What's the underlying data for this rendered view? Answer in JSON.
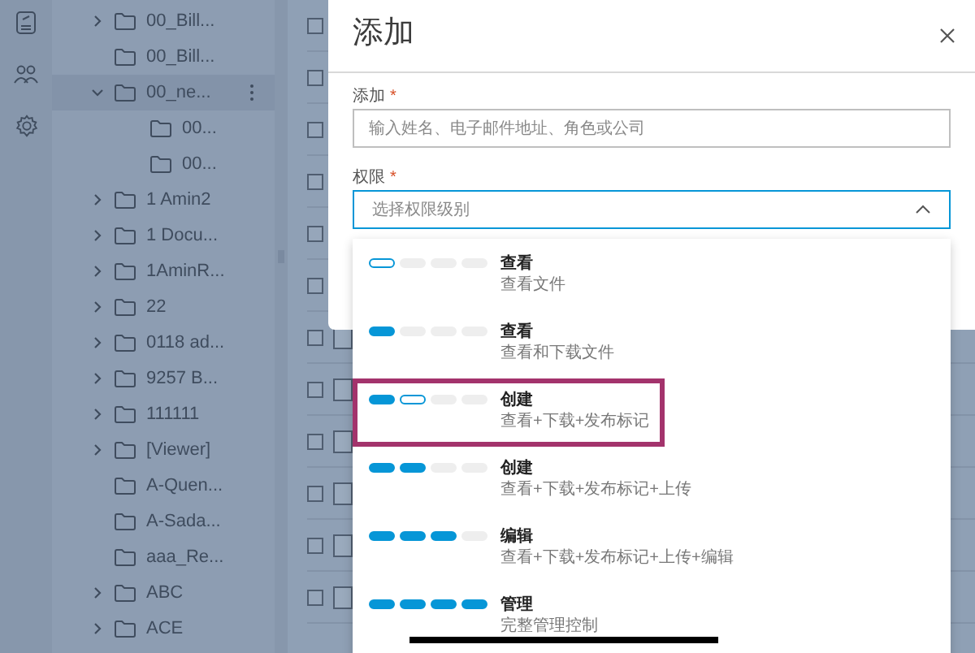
{
  "tree": [
    {
      "label": "00_Bill...",
      "expandable": true,
      "expanded": false,
      "selected": false
    },
    {
      "label": "00_Bill...",
      "expandable": false,
      "selected": false
    },
    {
      "label": "00_ne...",
      "expandable": true,
      "expanded": true,
      "selected": true,
      "children": [
        {
          "label": "00..."
        },
        {
          "label": "00..."
        }
      ]
    },
    {
      "label": "1 Amin2",
      "expandable": true,
      "expanded": false,
      "selected": false
    },
    {
      "label": "1 Docu...",
      "expandable": true,
      "expanded": false,
      "selected": false
    },
    {
      "label": "1AminR...",
      "expandable": true,
      "expanded": false,
      "selected": false
    },
    {
      "label": "22",
      "expandable": true,
      "expanded": false,
      "selected": false
    },
    {
      "label": "0118 ad...",
      "expandable": true,
      "expanded": false,
      "selected": false
    },
    {
      "label": "9257 B...",
      "expandable": true,
      "expanded": false,
      "selected": false
    },
    {
      "label": "111111",
      "expandable": true,
      "expanded": false,
      "selected": false
    },
    {
      "label": "[Viewer]",
      "expandable": true,
      "expanded": false,
      "selected": false
    },
    {
      "label": "A-Quen...",
      "expandable": false,
      "selected": false
    },
    {
      "label": "A-Sada...",
      "expandable": false,
      "selected": false
    },
    {
      "label": "aaa_Re...",
      "expandable": false,
      "selected": false
    },
    {
      "label": "ABC",
      "expandable": true,
      "expanded": false,
      "selected": false
    },
    {
      "label": "ACE",
      "expandable": true,
      "expanded": false,
      "selected": false
    }
  ],
  "rows": [
    {
      "checked": false,
      "thumbnail": false
    },
    {
      "checked": false,
      "thumbnail": false
    },
    {
      "checked": false,
      "thumbnail": false
    },
    {
      "checked": false,
      "thumbnail": false
    },
    {
      "checked": false,
      "thumbnail": false
    },
    {
      "checked": false,
      "thumbnail": false
    },
    {
      "checked": false,
      "thumbnail": true
    },
    {
      "checked": false,
      "thumbnail": true
    },
    {
      "checked": false,
      "thumbnail": true
    },
    {
      "checked": false,
      "thumbnail": true
    },
    {
      "checked": false,
      "thumbnail": true
    },
    {
      "checked": false,
      "thumbnail": true
    }
  ],
  "dialog": {
    "title": "添加",
    "add_field": {
      "label": "添加",
      "required_mark": "*",
      "placeholder": "输入姓名、电子邮件地址、角色或公司"
    },
    "permission_field": {
      "label": "权限",
      "required_mark": "*",
      "placeholder": "选择权限级别",
      "expanded": true
    },
    "options": [
      {
        "title": "查看",
        "description": "查看文件",
        "highlighted": false,
        "pips": [
          {
            "kind": "outline"
          },
          {
            "kind": "empty"
          },
          {
            "kind": "empty"
          },
          {
            "kind": "empty"
          }
        ]
      },
      {
        "title": "查看",
        "description": "查看和下载文件",
        "highlighted": false,
        "pips": [
          {
            "kind": "filled"
          },
          {
            "kind": "empty"
          },
          {
            "kind": "empty"
          },
          {
            "kind": "empty"
          }
        ]
      },
      {
        "title": "创建",
        "description": "查看+下载+发布标记",
        "highlighted": true,
        "pips": [
          {
            "kind": "filled"
          },
          {
            "kind": "outline"
          },
          {
            "kind": "empty"
          },
          {
            "kind": "empty"
          }
        ]
      },
      {
        "title": "创建",
        "description": "查看+下载+发布标记+上传",
        "highlighted": false,
        "pips": [
          {
            "kind": "filled"
          },
          {
            "kind": "filled"
          },
          {
            "kind": "empty"
          },
          {
            "kind": "empty"
          }
        ]
      },
      {
        "title": "编辑",
        "description": "查看+下载+发布标记+上传+编辑",
        "highlighted": false,
        "pips": [
          {
            "kind": "filled"
          },
          {
            "kind": "filled"
          },
          {
            "kind": "filled"
          },
          {
            "kind": "empty"
          }
        ]
      },
      {
        "title": "管理",
        "description": "完整管理控制",
        "highlighted": false,
        "pips": [
          {
            "kind": "filled"
          },
          {
            "kind": "filled"
          },
          {
            "kind": "filled"
          },
          {
            "kind": "filled"
          }
        ]
      }
    ]
  }
}
